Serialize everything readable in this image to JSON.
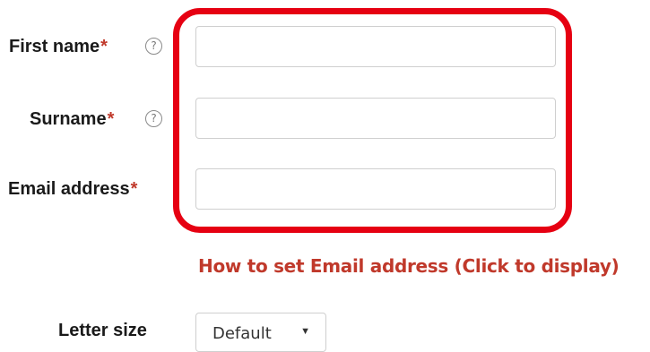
{
  "form": {
    "first_name": {
      "label": "First name",
      "required_mark": "*",
      "help_icon": "?",
      "value": "",
      "placeholder": ""
    },
    "surname": {
      "label": "Surname",
      "required_mark": "*",
      "help_icon": "?",
      "value": "",
      "placeholder": ""
    },
    "email": {
      "label": "Email address",
      "required_mark": "*",
      "value": "",
      "placeholder": ""
    },
    "email_help_link": "How to set Email address (Click to display)",
    "letter_size": {
      "label": "Letter size",
      "selected": "Default",
      "arrow": "▼"
    }
  },
  "colors": {
    "required": "#c0392b",
    "link": "#c0392b",
    "highlight_border": "#e60012"
  },
  "icons": {
    "help": "question-circle-icon",
    "dropdown": "caret-down-icon"
  }
}
